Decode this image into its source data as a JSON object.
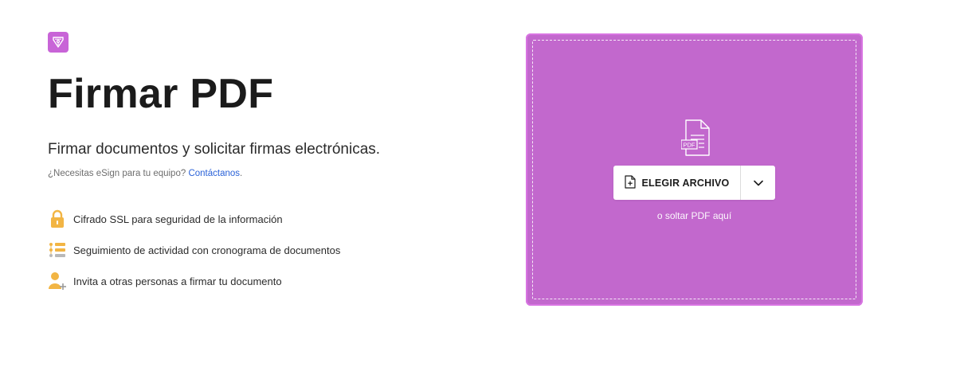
{
  "page": {
    "title": "Firmar PDF",
    "subtitle": "Firmar documentos y solicitar firmas electrónicas.",
    "esign_prompt": "¿Necesitas eSign para tu equipo?",
    "esign_link": "Contáctanos",
    "esign_suffix": "."
  },
  "features": [
    {
      "icon": "lock-icon",
      "text": "Cifrado SSL para seguridad de la información"
    },
    {
      "icon": "timeline-list-icon",
      "text": "Seguimiento de actividad con cronograma de documentos"
    },
    {
      "icon": "invite-user-icon",
      "text": "Invita a otras personas a firmar tu documento"
    }
  ],
  "dropzone": {
    "file_badge": "PDF",
    "choose_label": "ELEGIR ARCHIVO",
    "drop_hint": "o soltar PDF aquí"
  },
  "colors": {
    "accent": "#c864d7",
    "dropzone_bg": "#c268cd",
    "link": "#2a62d8",
    "feature_icon": "#f2b544"
  }
}
